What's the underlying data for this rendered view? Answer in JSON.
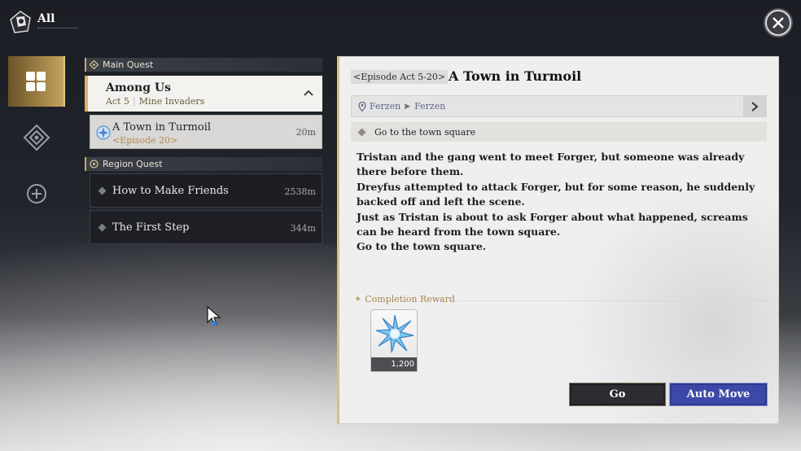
{
  "header": {
    "title": "All"
  },
  "rail": {
    "items": [
      {
        "icon": "grid-icon",
        "active": true
      },
      {
        "icon": "main-quest-icon",
        "active": false
      },
      {
        "icon": "region-quest-icon",
        "active": false
      }
    ]
  },
  "quest_list": {
    "main_header": "Main Quest",
    "group": {
      "title": "Among Us",
      "act": "Act 5",
      "chapter": "Mine Invaders"
    },
    "active_quest": {
      "title": "A Town in Turmoil",
      "episode": "<Episode 20>",
      "distance": "20m"
    },
    "region_header": "Region Quest",
    "region_quests": [
      {
        "title": "How to Make Friends",
        "distance": "2538m"
      },
      {
        "title": "The First Step",
        "distance": "344m"
      }
    ]
  },
  "detail": {
    "episode_tag": "<Episode Act 5-20>",
    "title": "A Town in Turmoil",
    "location_from": "Ferzen",
    "location_to": "Ferzen",
    "objective": "Go to the town square",
    "description": [
      "Tristan and the gang went to meet Forger, but someone was already there before them.",
      "Dreyfus attempted to attack Forger, but for some reason, he suddenly backed off and left the scene.",
      "Just as Tristan is about to ask Forger about what happened, screams can be heard from the town square.",
      "Go to the town square."
    ],
    "reward_header": "Completion Reward",
    "reward": {
      "icon": "star-crystal-icon",
      "amount": "1,200"
    },
    "go_label": "Go",
    "auto_move_label": "Auto Move"
  },
  "colors": {
    "gold_accent": "#c9a764",
    "auto_move_blue": "#3d49a8",
    "panel_bg": "#efefef"
  }
}
